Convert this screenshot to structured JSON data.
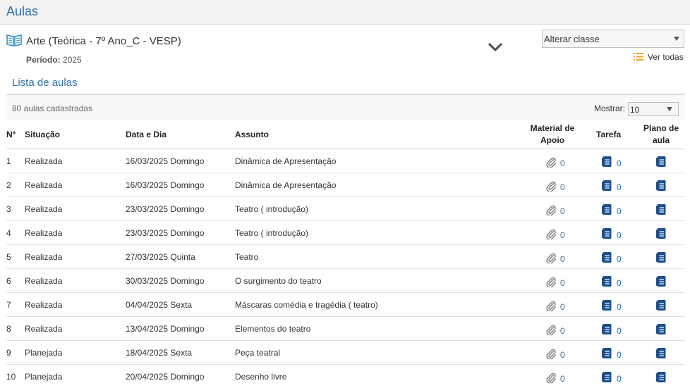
{
  "page_title": "Aulas",
  "class": {
    "name": "Arte (Teórica - 7º Ano_C - VESP)",
    "periodo_label": "Período:",
    "periodo_value": "2025"
  },
  "alterar_classe": {
    "value": "Alterar classe"
  },
  "ver_todas": "Ver todas",
  "lista": {
    "title": "Lista de aulas",
    "count_text": "80 aulas cadastradas",
    "mostrar_label": "Mostrar:",
    "mostrar_value": "10"
  },
  "table": {
    "headers": {
      "num": "Nº",
      "situacao": "Situação",
      "data": "Data e Dia",
      "assunto": "Assunto",
      "material_1": "Material de",
      "material_2": "Apoio",
      "tarefa": "Tarefa",
      "plano_1": "Plano de",
      "plano_2": "aula"
    },
    "rows": [
      {
        "num": "1",
        "situacao": "Realizada",
        "data": "16/03/2025 Domingo",
        "assunto": "Dinâmica de Apresentação",
        "material": "0",
        "tarefa": "0"
      },
      {
        "num": "2",
        "situacao": "Realizada",
        "data": "16/03/2025 Domingo",
        "assunto": "Dinâmica de Apresentação",
        "material": "0",
        "tarefa": "0"
      },
      {
        "num": "3",
        "situacao": "Realizada",
        "data": "23/03/2025 Domingo",
        "assunto": "Teatro ( introdução)",
        "material": "0",
        "tarefa": "0"
      },
      {
        "num": "4",
        "situacao": "Realizada",
        "data": "23/03/2025 Domingo",
        "assunto": "Teatro ( introdução)",
        "material": "0",
        "tarefa": "0"
      },
      {
        "num": "5",
        "situacao": "Realizada",
        "data": "27/03/2025 Quinta",
        "assunto": "Teatro",
        "material": "0",
        "tarefa": "0"
      },
      {
        "num": "6",
        "situacao": "Realizada",
        "data": "30/03/2025 Domingo",
        "assunto": "O surgimento do teatro",
        "material": "0",
        "tarefa": "0"
      },
      {
        "num": "7",
        "situacao": "Realizada",
        "data": "04/04/2025 Sexta",
        "assunto": "Máscaras comédia e tragédia ( teatro)",
        "material": "0",
        "tarefa": "0"
      },
      {
        "num": "8",
        "situacao": "Realizada",
        "data": "13/04/2025 Domingo",
        "assunto": "Elementos do teatro",
        "material": "0",
        "tarefa": "0"
      },
      {
        "num": "9",
        "situacao": "Planejada",
        "data": "18/04/2025 Sexta",
        "assunto": "Peça teatral",
        "material": "0",
        "tarefa": "0"
      },
      {
        "num": "10",
        "situacao": "Planejada",
        "data": "20/04/2025 Domingo",
        "assunto": "Desenho livre",
        "material": "0",
        "tarefa": "0"
      }
    ]
  },
  "colors": {
    "accent_blue": "#2f6fa6",
    "icon_navy": "#1f4e8c",
    "list_icon_orange": "#f0a030"
  },
  "icons": {
    "class": "open-book-icon",
    "expand": "chevron-down-icon",
    "ver_todas": "list-icon",
    "material": "paperclip-icon",
    "tarefa": "document-icon",
    "plano": "document-icon"
  }
}
